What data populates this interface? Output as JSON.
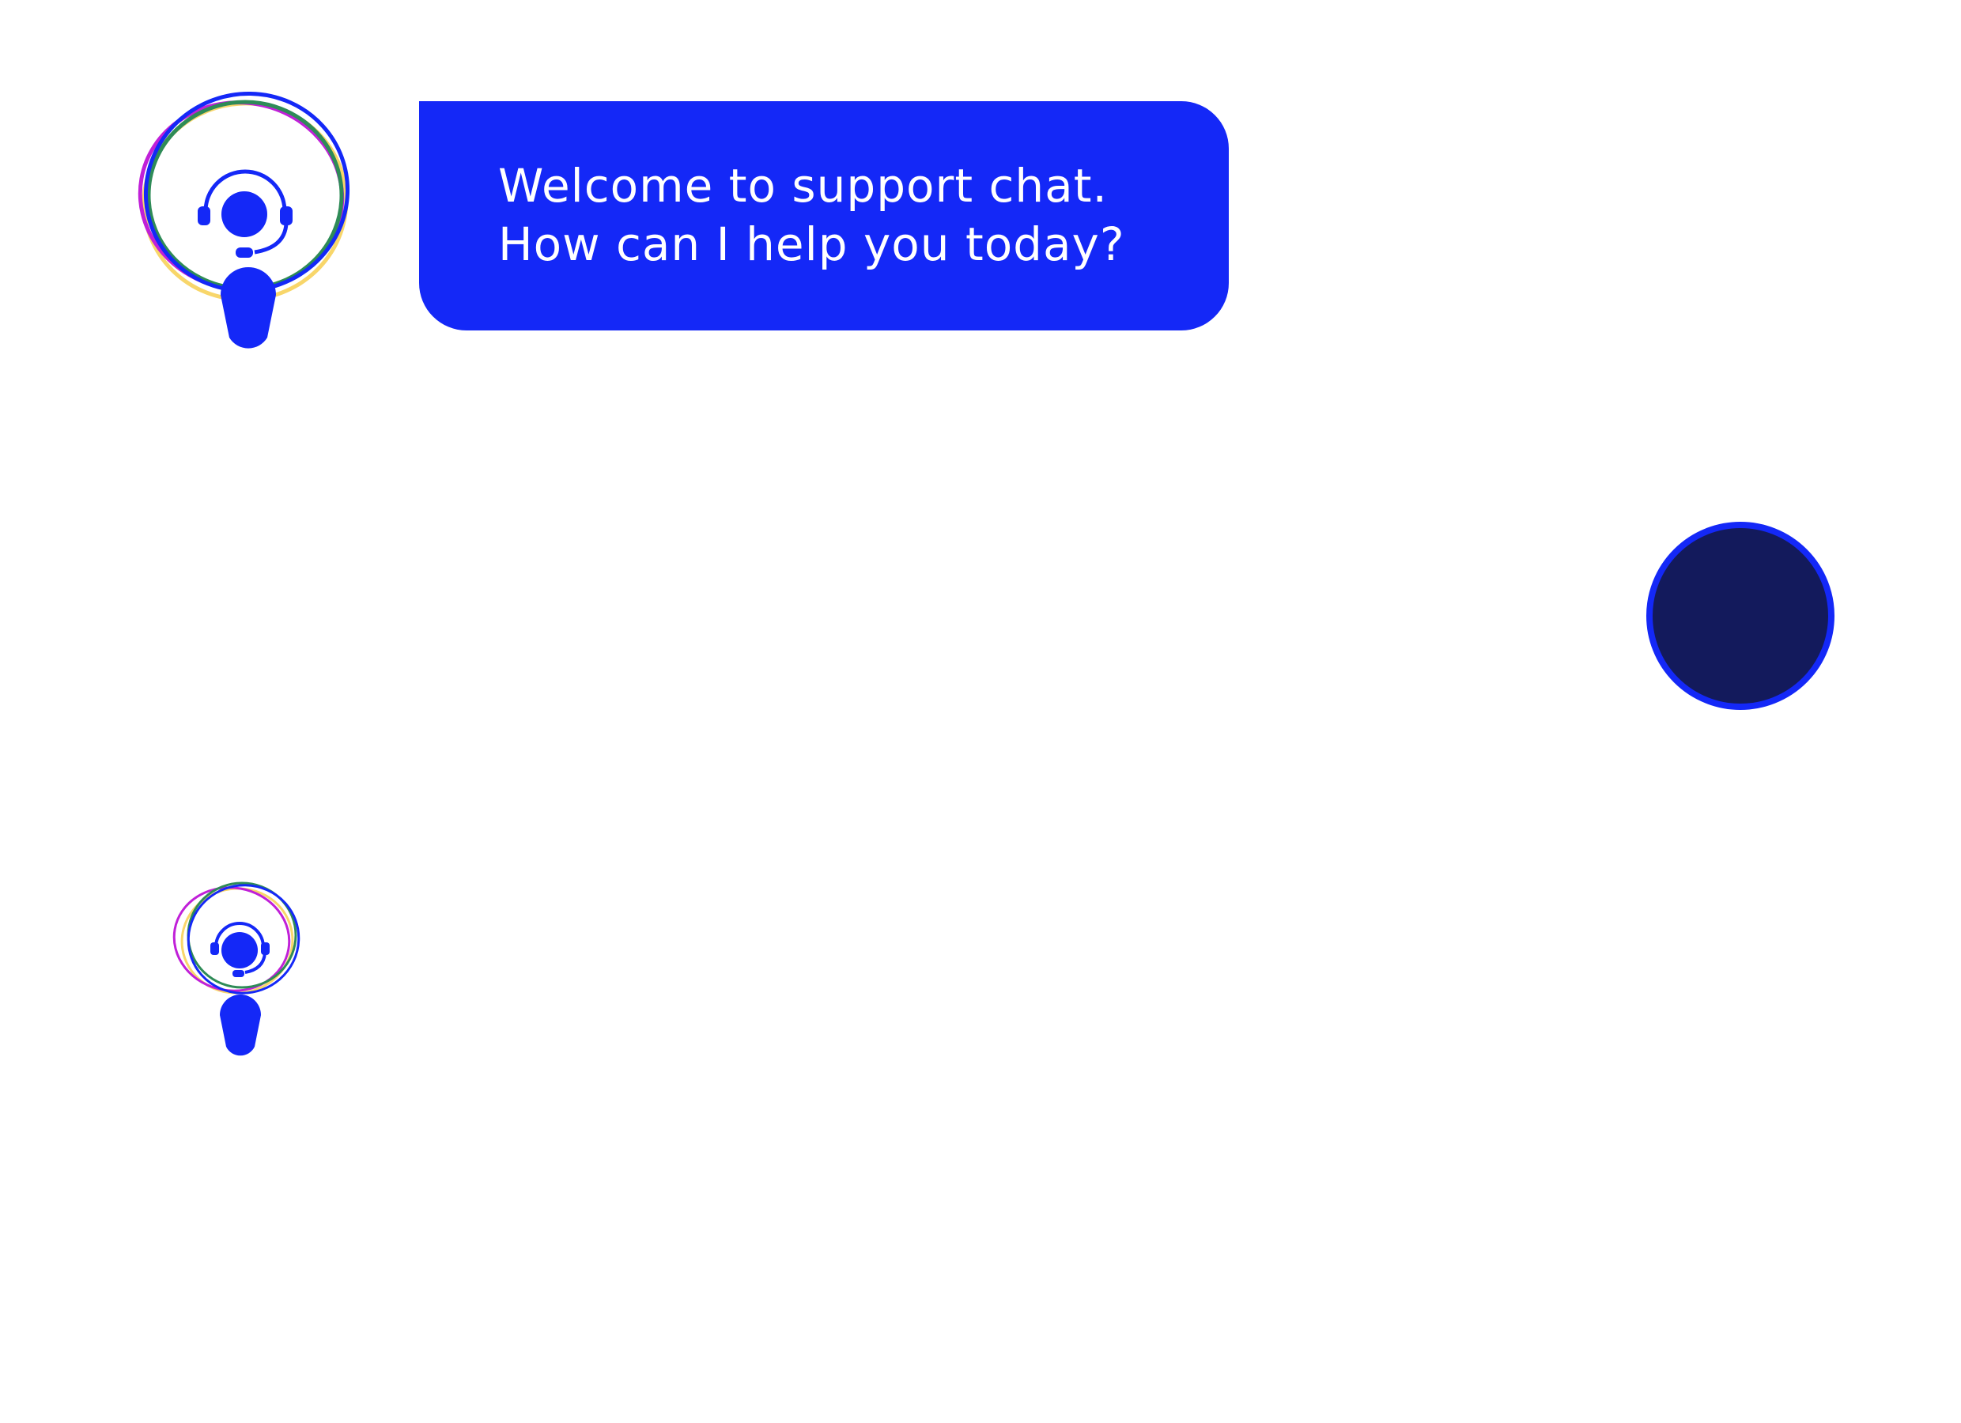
{
  "colors": {
    "accent": "#1428f7",
    "bubble_text": "#ffffff",
    "user_avatar_fill": "#131a5c",
    "ring_green": "#2e8b57",
    "ring_magenta": "#c020d8",
    "ring_yellow": "#f8d66a",
    "background": "#ffffff"
  },
  "chat": {
    "messages": [
      {
        "sender": "agent",
        "avatar_icon": "support-agent-headset-icon",
        "lines": [
          "Welcome to support chat.",
          "How can I help you today?"
        ]
      }
    ],
    "typing_indicator": {
      "avatar_icon": "support-agent-headset-icon"
    },
    "user": {
      "avatar_icon": "user-avatar-circle"
    }
  }
}
